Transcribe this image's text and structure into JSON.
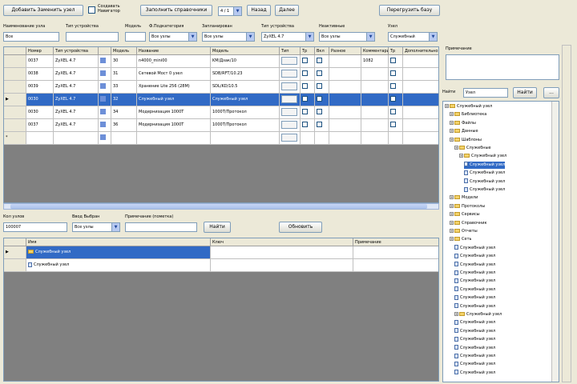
{
  "toolbar": {
    "btn1": "Добавить Заменить узел",
    "chk1": "Создавать\nНавигатор",
    "btn2": "Заполнить справочники",
    "page": "4 / 1",
    "btn3": "Назад",
    "btn4": "Далее",
    "btn5": "Перегрузить базу"
  },
  "filters": [
    {
      "label": "Наименование узла",
      "value": "Все",
      "kind": "input"
    },
    {
      "label": "Тип устройства",
      "value": "",
      "kind": "input"
    },
    {
      "label": "Модель",
      "value": "",
      "kind": "input"
    },
    {
      "label": "Ф.Подкатегория",
      "value": "Все узлы",
      "kind": "combo"
    },
    {
      "label": "Запланирован",
      "value": "Все узлы",
      "kind": "combo"
    },
    {
      "label": "Тип устройства",
      "value": "ZyXEL 4.7",
      "kind": "combo"
    },
    {
      "label": "Неактивные",
      "value": "Все узлы",
      "kind": "combo"
    },
    {
      "label": "Узел",
      "value": "Служебный",
      "kind": "combo"
    }
  ],
  "grid1": {
    "columns": [
      "",
      "Номер",
      "Тип устройства",
      "",
      "Модель",
      "Название",
      "Модель",
      "Тип",
      "Тр",
      "Вкл",
      "Разное",
      "Комментарий",
      "Тр",
      "Дополнительно"
    ],
    "rows": [
      {
        "marker": "",
        "id": "0037",
        "type": "ZyXEL 4.7",
        "n": "30",
        "name": "n4000_mini00",
        "model": "KM/Дзак/10",
        "extra": "1082"
      },
      {
        "marker": "",
        "id": "0038",
        "type": "ZyXEL 4.7",
        "n": "31",
        "name": "Сетевой Мост 0 узел",
        "model": "SDB/RFT/10.23",
        "extra": ""
      },
      {
        "marker": "",
        "id": "0039",
        "type": "ZyXEL 4.7",
        "n": "33",
        "name": "Хранение Lite 256 (28M)",
        "model": "SDL/KD/10.5",
        "extra": ""
      },
      {
        "marker": "▶",
        "id": "0030",
        "type": "ZyXEL 4.7",
        "n": "32",
        "name": "Служебный узел",
        "model": "Служебный узел",
        "extra": ""
      },
      {
        "marker": "",
        "id": "0030",
        "type": "ZyXEL 4.7",
        "n": "34",
        "name": "Модернизация 1000Т",
        "model": "1000Т/Протокол",
        "extra": ""
      },
      {
        "marker": "",
        "id": "0037",
        "type": "ZyXEL 4.7",
        "n": "36",
        "name": "Модернизация 1000Т",
        "model": "1000Т/Протокол",
        "extra": ""
      },
      {
        "marker": "*",
        "id": "",
        "type": "",
        "n": "",
        "name": "",
        "model": "",
        "extra": ""
      }
    ]
  },
  "lower_filters": [
    {
      "label": "Кол узлов",
      "value": "100007",
      "kind": "input"
    },
    {
      "label": "Ввод Выбран",
      "value": "Все узлы",
      "kind": "combo"
    },
    {
      "label": "Примечание (пометка)",
      "value": "",
      "kind": "input"
    }
  ],
  "lower_buttons": {
    "btn1": "Найти",
    "btn2": "Обновить"
  },
  "grid2": {
    "columns": [
      "",
      "Имя",
      "Ключ",
      "Примечание"
    ],
    "rows": [
      {
        "marker": "▶",
        "name": "Служебный узел",
        "selected": true
      },
      {
        "marker": "",
        "name": "Служебный узел",
        "selected": false
      }
    ]
  },
  "side": {
    "note_label": "Примечание",
    "search_label": "Найти",
    "search_value": "Узел",
    "btn_find": "Найти",
    "btn_more": "...",
    "tree": [
      {
        "t": "Служебный узел",
        "d": 0,
        "k": "folder"
      },
      {
        "t": "Библиотека",
        "d": 1,
        "k": "folder"
      },
      {
        "t": "Файлы",
        "d": 1,
        "k": "folder"
      },
      {
        "t": "Данные",
        "d": 1,
        "k": "folder"
      },
      {
        "t": "Шаблоны",
        "d": 1,
        "k": "folder"
      },
      {
        "t": "Служебные",
        "d": 2,
        "k": "folder"
      },
      {
        "t": "Служебный узел",
        "d": 3,
        "k": "folder"
      },
      {
        "t": "Служебный узел",
        "d": 4,
        "k": "doc",
        "hl": true
      },
      {
        "t": "Служебный узел",
        "d": 4,
        "k": "doc"
      },
      {
        "t": "Служебный узел",
        "d": 4,
        "k": "doc"
      },
      {
        "t": "Служебный узел",
        "d": 4,
        "k": "doc"
      },
      {
        "t": "Модели",
        "d": 1,
        "k": "folder"
      },
      {
        "t": "Протоколы",
        "d": 1,
        "k": "folder"
      },
      {
        "t": "Сервисы",
        "d": 1,
        "k": "folder"
      },
      {
        "t": "Справочник",
        "d": 1,
        "k": "folder"
      },
      {
        "t": "Отчеты",
        "d": 1,
        "k": "folder"
      },
      {
        "t": "Сеть",
        "d": 1,
        "k": "folder"
      },
      {
        "t": "Служебный узел",
        "d": 2,
        "k": "doc"
      },
      {
        "t": "Служебный узел",
        "d": 2,
        "k": "doc"
      },
      {
        "t": "Служебный узел",
        "d": 2,
        "k": "doc"
      },
      {
        "t": "Служебный узел",
        "d": 2,
        "k": "doc"
      },
      {
        "t": "Служебный узел",
        "d": 2,
        "k": "doc"
      },
      {
        "t": "Служебный узел",
        "d": 2,
        "k": "doc"
      },
      {
        "t": "Служебный узел",
        "d": 2,
        "k": "doc"
      },
      {
        "t": "Служебный узел",
        "d": 2,
        "k": "doc"
      },
      {
        "t": "Служебный узел",
        "d": 2,
        "k": "folder"
      },
      {
        "t": "Служебный узел",
        "d": 2,
        "k": "doc"
      },
      {
        "t": "Служебный узел",
        "d": 2,
        "k": "doc"
      },
      {
        "t": "Служебный узел",
        "d": 2,
        "k": "doc"
      },
      {
        "t": "Служебный узел",
        "d": 2,
        "k": "doc"
      },
      {
        "t": "Служебный узел",
        "d": 2,
        "k": "doc"
      },
      {
        "t": "Служебный узел",
        "d": 2,
        "k": "doc"
      },
      {
        "t": "Служебный узел",
        "d": 2,
        "k": "doc"
      }
    ]
  }
}
